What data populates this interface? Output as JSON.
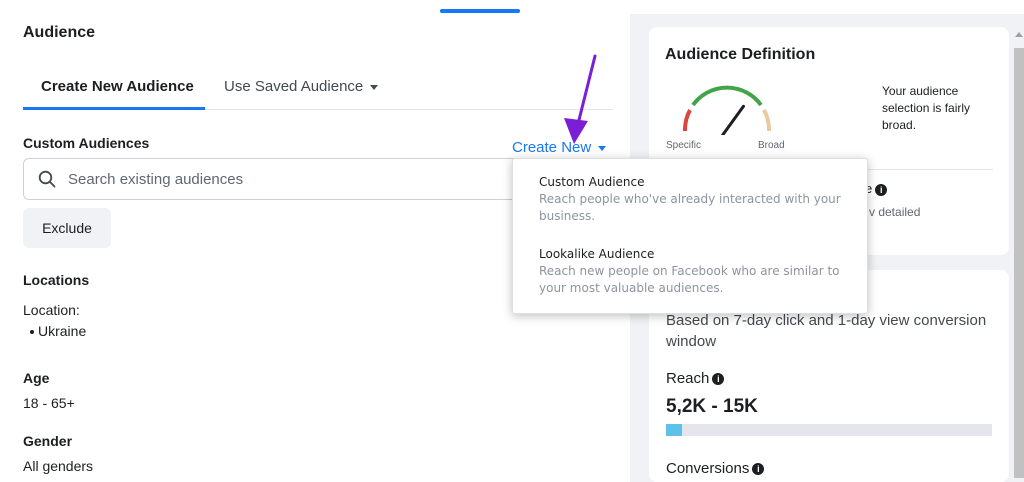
{
  "audience": {
    "title": "Audience",
    "tabs": [
      {
        "label": "Create New Audience",
        "active": true
      },
      {
        "label": "Use Saved Audience",
        "active": false
      }
    ],
    "custom_audiences": {
      "label": "Custom Audiences",
      "create_new_label": "Create New",
      "search_placeholder": "Search existing audiences",
      "exclude_label": "Exclude"
    },
    "locations": {
      "heading": "Locations",
      "sublabel": "Location:",
      "items": [
        "Ukraine"
      ]
    },
    "age": {
      "heading": "Age",
      "value": "18 - 65+"
    },
    "gender": {
      "heading": "Gender",
      "value": "All genders"
    }
  },
  "dropdown": {
    "items": [
      {
        "title": "Custom Audience",
        "description": "Reach people who've already interacted with your business."
      },
      {
        "title": "Lookalike Audience",
        "description": "Reach new people on Facebook who are similar to your most valuable audiences."
      }
    ]
  },
  "definition": {
    "title": "Audience Definition",
    "gauge_specific": "Specific",
    "gauge_broad": "Broad",
    "gauge_level": 0.7,
    "description": "Your audience selection is fairly broad.",
    "partial_label": "e",
    "partial_detailed": "v detailed"
  },
  "estimates": {
    "window_text": "Based on 7-day click and 1-day view conversion window",
    "reach_label": "Reach",
    "reach_value": "5,2K - 15K",
    "reach_fraction": 0.05,
    "conversions_label": "Conversions"
  },
  "colors": {
    "accent": "#1877f2",
    "arrow": "#7b1fd6",
    "reach_bar": "#5dc1ea",
    "gauge_red": "#e0443e",
    "gauge_green": "#42a446",
    "gauge_tan": "#e8c9a0"
  },
  "icons": {
    "search": "search-icon",
    "caret": "caret-down-icon",
    "info": "info-icon",
    "gauge": "gauge-icon",
    "arrow": "annotation-arrow-icon"
  }
}
